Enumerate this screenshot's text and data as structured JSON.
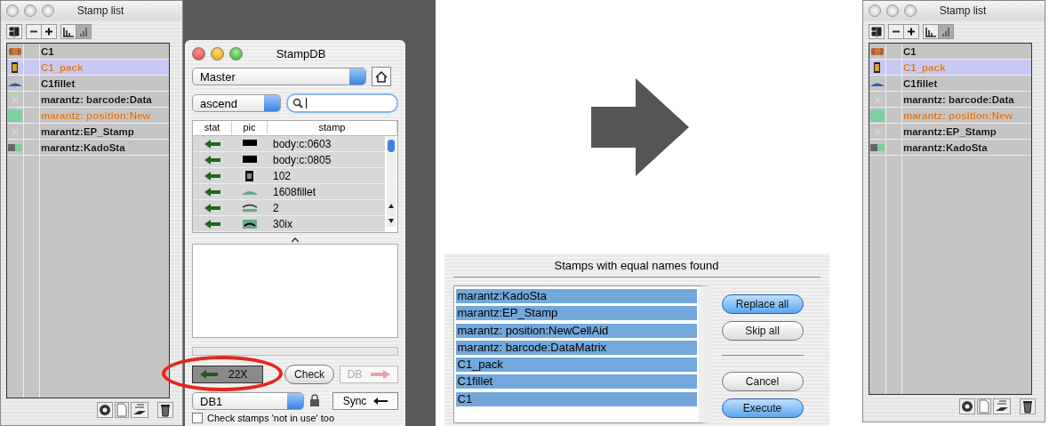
{
  "stamp_list_left": {
    "title": "Stamp list",
    "rows": [
      {
        "name": "C1",
        "color": "#111111",
        "selected": false
      },
      {
        "name": "C1_pack",
        "color": "#d9731f",
        "selected": true
      },
      {
        "name": "C1fillet",
        "color": "#111111",
        "selected": false
      },
      {
        "name": "marantz: barcode:Data",
        "color": "#111111",
        "selected": false
      },
      {
        "name": "marantz: position:New",
        "color": "#d9731f",
        "selected": false
      },
      {
        "name": "marantz:EP_Stamp",
        "color": "#111111",
        "selected": false
      },
      {
        "name": "marantz:KadoSta",
        "color": "#111111",
        "selected": false
      }
    ]
  },
  "stamp_db": {
    "title": "StampDB",
    "source": "Master",
    "sort": "ascend",
    "columns": [
      "stat",
      "pic",
      "stamp"
    ],
    "rows": [
      "body:c:0603",
      "body:c:0805",
      "102",
      "1608fillet",
      "2",
      "30ix"
    ],
    "progress": {
      "level": 0
    },
    "count_button": "22X",
    "check_button": "Check",
    "db_button": {
      "label": "DB",
      "disabled": true
    },
    "database": "DB1",
    "sync_button": "Sync",
    "checkbox": {
      "label": "Check stamps 'not in use' too",
      "checked": false
    }
  },
  "dialog": {
    "title": "Stamps with equal names found",
    "items": [
      {
        "name": "marantz:KadoSta",
        "selected": true
      },
      {
        "name": "marantz:EP_Stamp",
        "selected": true
      },
      {
        "name": "marantz: position:NewCellAid",
        "selected": true
      },
      {
        "name": "marantz: barcode:DataMatrix",
        "selected": true
      },
      {
        "name": "C1_pack",
        "selected": true
      },
      {
        "name": "C1fillet",
        "selected": true
      },
      {
        "name": "C1",
        "selected": true
      }
    ],
    "top_buttons": [
      {
        "label": "Replace all",
        "kind": "default"
      },
      {
        "label": "Skip all",
        "kind": "normal"
      }
    ],
    "bottom_buttons": [
      {
        "label": "Cancel",
        "kind": "normal"
      },
      {
        "label": "Execute",
        "kind": "default"
      }
    ]
  },
  "stamp_list_right": {
    "title": "Stamp list",
    "rows": [
      {
        "name": "C1",
        "color": "#111111",
        "selected": false
      },
      {
        "name": "C1_pack",
        "color": "#d9731f",
        "selected": true
      },
      {
        "name": "C1fillet",
        "color": "#111111",
        "selected": false
      },
      {
        "name": "marantz: barcode:Data",
        "color": "#111111",
        "selected": false
      },
      {
        "name": "marantz: position:New",
        "color": "#d9731f",
        "selected": false
      },
      {
        "name": "marantz:EP_Stamp",
        "color": "#111111",
        "selected": false
      },
      {
        "name": "marantz:KadoSta",
        "color": "#111111",
        "selected": false
      }
    ]
  }
}
